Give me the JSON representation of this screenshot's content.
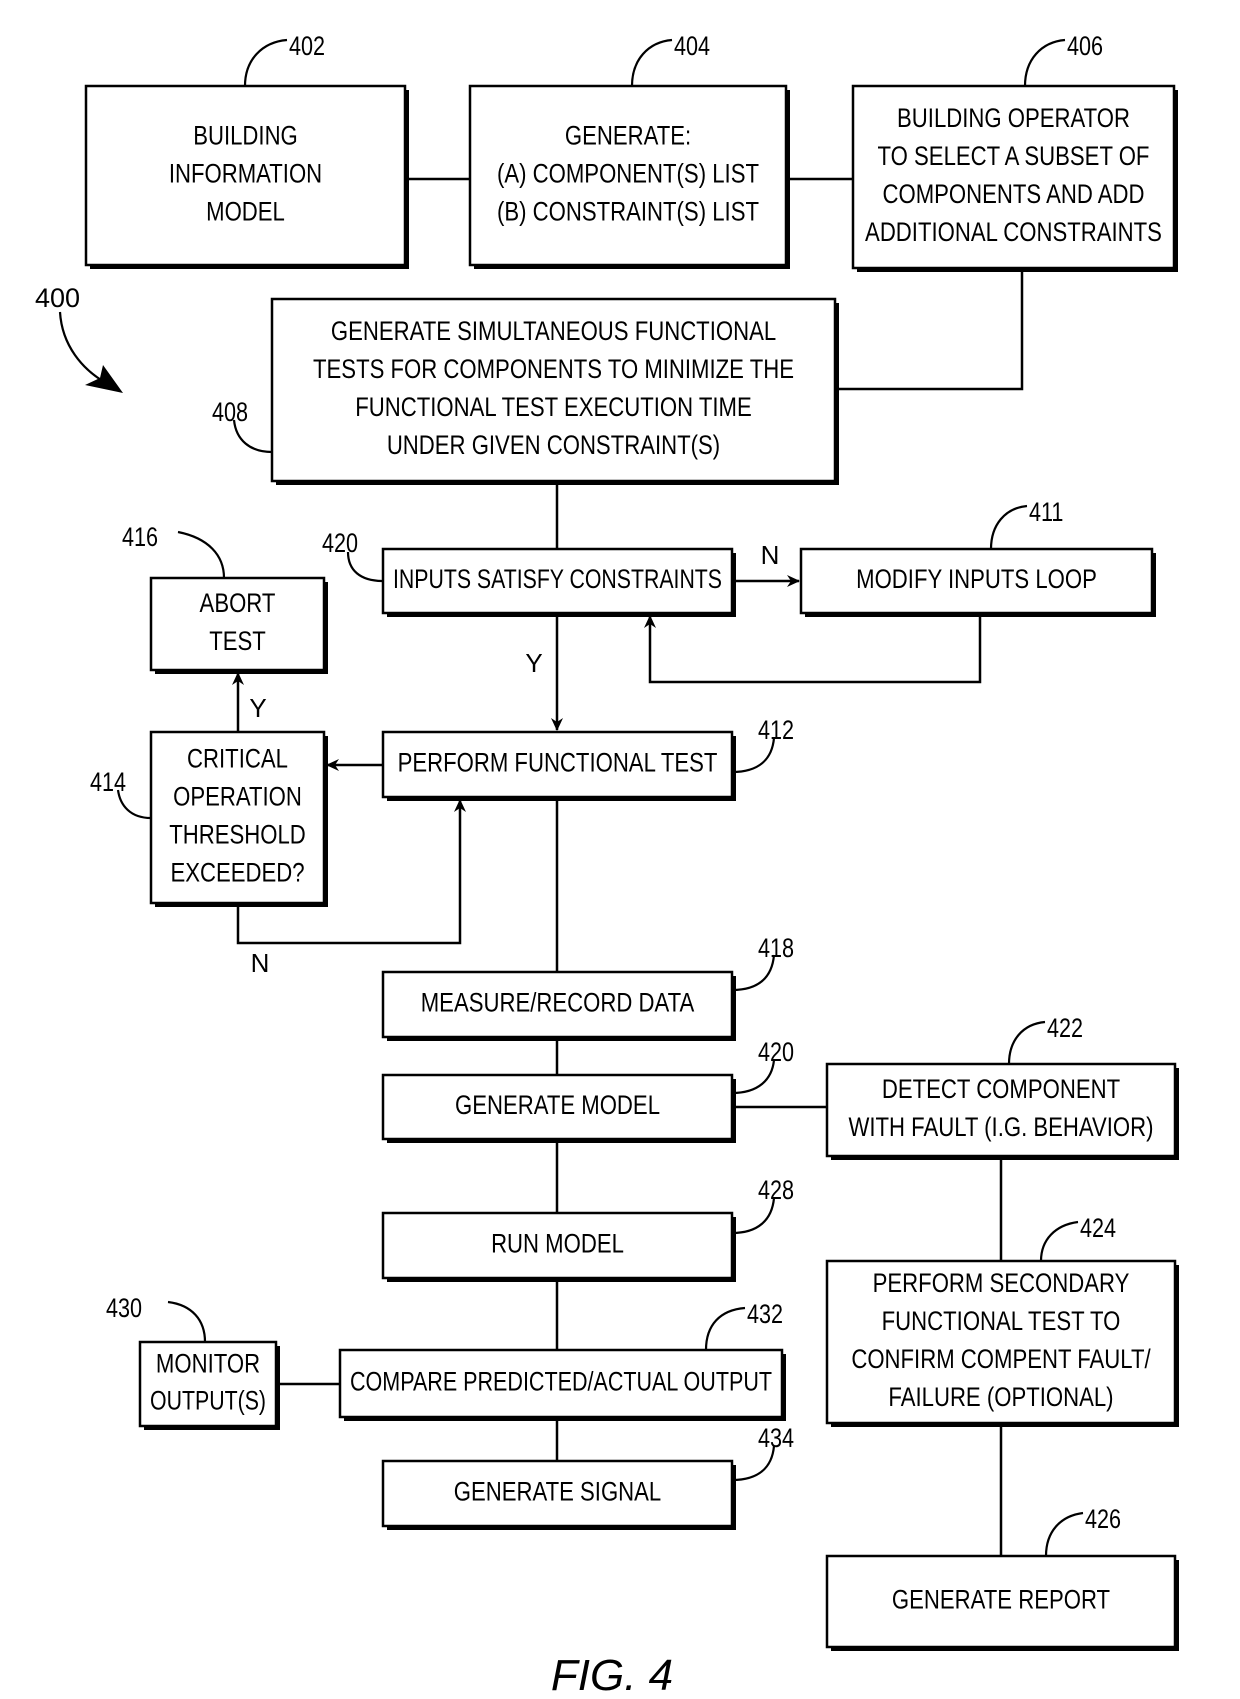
{
  "figure": {
    "label": "FIG. 4",
    "reference": "400"
  },
  "nodes": [
    {
      "id": "402",
      "ref": "402",
      "lines": [
        "BUILDING",
        "INFORMATION",
        "MODEL"
      ]
    },
    {
      "id": "404",
      "ref": "404",
      "lines": [
        "GENERATE:",
        "(A) COMPONENT(S) LIST",
        "(B) CONSTRAINT(S) LIST"
      ]
    },
    {
      "id": "406",
      "ref": "406",
      "lines": [
        "BUILDING OPERATOR",
        "TO SELECT A SUBSET OF",
        "COMPONENTS AND ADD",
        "ADDITIONAL CONSTRAINTS"
      ]
    },
    {
      "id": "408",
      "ref": "408",
      "lines": [
        "GENERATE SIMULTANEOUS FUNCTIONAL",
        "TESTS FOR COMPONENTS TO MINIMIZE THE",
        "FUNCTIONAL TEST EXECUTION TIME",
        "UNDER GIVEN CONSTRAINT(S)"
      ]
    },
    {
      "id": "420a",
      "ref": "420",
      "lines": [
        "INPUTS SATISFY CONSTRAINTS"
      ]
    },
    {
      "id": "411",
      "ref": "411",
      "lines": [
        "MODIFY INPUTS LOOP"
      ]
    },
    {
      "id": "416",
      "ref": "416",
      "lines": [
        "ABORT",
        "TEST"
      ]
    },
    {
      "id": "414",
      "ref": "414",
      "lines": [
        "CRITICAL",
        "OPERATION",
        "THRESHOLD",
        "EXCEEDED?"
      ]
    },
    {
      "id": "412",
      "ref": "412",
      "lines": [
        "PERFORM FUNCTIONAL TEST"
      ]
    },
    {
      "id": "418",
      "ref": "418",
      "lines": [
        "MEASURE/RECORD DATA"
      ]
    },
    {
      "id": "420b",
      "ref": "420",
      "lines": [
        "GENERATE MODEL"
      ]
    },
    {
      "id": "422",
      "ref": "422",
      "lines": [
        "DETECT COMPONENT",
        "WITH FAULT (I.G. BEHAVIOR)"
      ]
    },
    {
      "id": "428",
      "ref": "428",
      "lines": [
        "RUN MODEL"
      ]
    },
    {
      "id": "430",
      "ref": "430",
      "lines": [
        "MONITOR",
        "OUTPUT(S)"
      ]
    },
    {
      "id": "432",
      "ref": "432",
      "lines": [
        "COMPARE PREDICTED/ACTUAL OUTPUT"
      ]
    },
    {
      "id": "434",
      "ref": "434",
      "lines": [
        "GENERATE SIGNAL"
      ]
    },
    {
      "id": "424",
      "ref": "424",
      "lines": [
        "PERFORM SECONDARY",
        "FUNCTIONAL TEST TO",
        "CONFIRM COMPENT FAULT/",
        "FAILURE (OPTIONAL)"
      ]
    },
    {
      "id": "426",
      "ref": "426",
      "lines": [
        "GENERATE REPORT"
      ]
    }
  ],
  "branch_labels": {
    "constraints_no": "N",
    "constraints_yes": "Y",
    "threshold_yes": "Y",
    "threshold_no": "N"
  }
}
